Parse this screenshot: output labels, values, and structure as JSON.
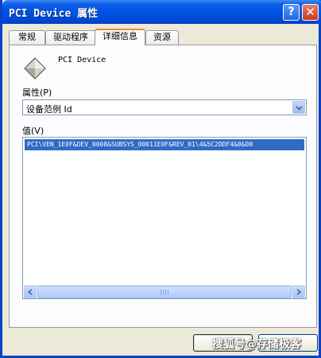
{
  "window": {
    "title": "PCI Device 属性",
    "help_symbol": "?",
    "close_symbol": "✕"
  },
  "tabs": [
    {
      "label": "常规"
    },
    {
      "label": "驱动程序"
    },
    {
      "label": "详细信息",
      "active": true
    },
    {
      "label": "资源"
    }
  ],
  "device": {
    "name": "PCI Device",
    "icon": "generic-device-icon"
  },
  "property": {
    "label": "属性(P)",
    "selected": "设备范例 Id"
  },
  "value": {
    "label": "值(V)",
    "items": [
      "PCI\\VEN_1E0F&DEV_0008&SUBSYS_00011E0F&REV_01\\4&5C2DDF4&0&00"
    ]
  },
  "footer": {
    "watermark": "搜狐号@存储极客"
  },
  "colors": {
    "titlebar": "#0055e5",
    "selection": "#316ac5",
    "active_tab_accent": "#e68b2c"
  }
}
